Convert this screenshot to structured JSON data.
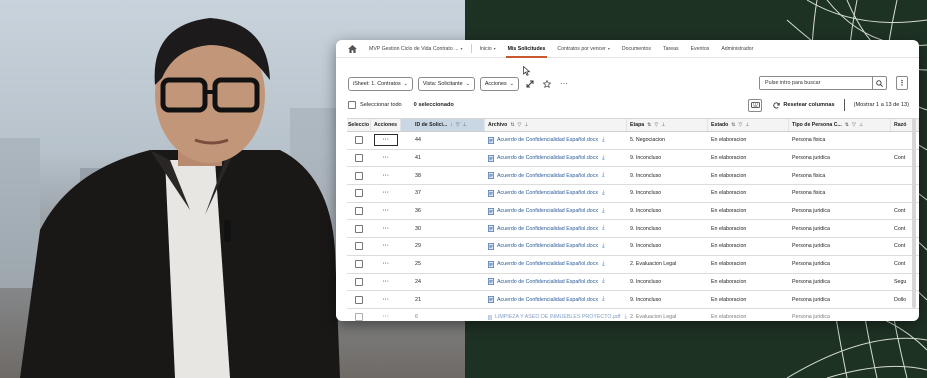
{
  "nav": {
    "items": [
      {
        "label": "MVP Gestion Ciclo de Vida Contrato ...",
        "chevron": true
      },
      {
        "label": "Inicio",
        "chevron": true
      },
      {
        "label": "Mis Solicitudes",
        "chevron": false,
        "active": true
      },
      {
        "label": "Contratos por vencer",
        "chevron": true
      },
      {
        "label": "Documentos",
        "chevron": false
      },
      {
        "label": "Tareas",
        "chevron": false
      },
      {
        "label": "Eventos",
        "chevron": false
      },
      {
        "label": "Administrador",
        "chevron": false
      }
    ]
  },
  "toolbar": {
    "sheet_label": "iSheet: 1. Contratos",
    "view_label": "Vista: Solicitante",
    "actions_label": "Acciones",
    "more_label": "···",
    "search_placeholder": "Pulse intro para buscar",
    "kebab_label": "⋮"
  },
  "selection": {
    "select_all_label": "Seleccionar todo",
    "selected_count": "0 seleccionado",
    "reset_label": "Resetear columnas",
    "range_label": "(Mostrar 1 a 13 de 13)"
  },
  "table": {
    "columns": {
      "select": "Seleccio",
      "actions": "Acciones",
      "id": "ID de Solici...",
      "file": "Archivo",
      "stage": "Etapa",
      "status": "Estado",
      "person_type": "Tipo de Persona C...",
      "reason": "Razó"
    },
    "rows": [
      {
        "actions": "···",
        "id": "44",
        "file": "Acuerdo de Confidencialidad Español.docx",
        "stage": "5. Negociacion",
        "status": "En elaboracion",
        "person_type": "Persona fisica",
        "reason": ""
      },
      {
        "actions": "···",
        "id": "41",
        "file": "Acuerdo de Confidencialidad Español.docx",
        "stage": "9. Inconcluso",
        "status": "En elaboracion",
        "person_type": "Persona juridica",
        "reason": "Cont"
      },
      {
        "actions": "···",
        "id": "38",
        "file": "Acuerdo de Confidencialidad Español.docx",
        "stage": "9. Inconcluso",
        "status": "En elaboracion",
        "person_type": "Persona fisica",
        "reason": ""
      },
      {
        "actions": "···",
        "id": "37",
        "file": "Acuerdo de Confidencialidad Español.docx",
        "stage": "9. Inconcluso",
        "status": "En elaboracion",
        "person_type": "Persona fisica",
        "reason": ""
      },
      {
        "actions": "···",
        "id": "36",
        "file": "Acuerdo de Confidencialidad Español.docx",
        "stage": "9. Inconcluso",
        "status": "En elaboracion",
        "person_type": "Persona juridica",
        "reason": "Cont"
      },
      {
        "actions": "···",
        "id": "30",
        "file": "Acuerdo de Confidencialidad Español.docx",
        "stage": "9. Inconcluso",
        "status": "En elaboracion",
        "person_type": "Persona juridica",
        "reason": "Cont"
      },
      {
        "actions": "···",
        "id": "29",
        "file": "Acuerdo de Confidencialidad Español.docx",
        "stage": "9. Inconcluso",
        "status": "En elaboracion",
        "person_type": "Persona juridica",
        "reason": "Cont"
      },
      {
        "actions": "···",
        "id": "25",
        "file": "Acuerdo de Confidencialidad Español.docx",
        "stage": "2. Evaluacion Legal",
        "status": "En elaboracion",
        "person_type": "Persona juridica",
        "reason": "Cont"
      },
      {
        "actions": "···",
        "id": "24",
        "file": "Acuerdo de Confidencialidad Español.docx",
        "stage": "9. Inconcluso",
        "status": "En elaboracion",
        "person_type": "Persona juridica",
        "reason": "Segu"
      },
      {
        "actions": "···",
        "id": "21",
        "file": "Acuerdo de Confidencialidad Español.docx",
        "stage": "9. Inconcluso",
        "status": "En elaboracion",
        "person_type": "Persona juridica",
        "reason": "Dollo"
      },
      {
        "actions": "···",
        "id": "6",
        "file": "LIMPIEZA Y ASEO DE INMUEBLES PROYECTO.pdf",
        "stage": "2. Evaluacion Legal",
        "status": "En elaboracion",
        "person_type": "Persona juridica",
        "reason": ""
      }
    ]
  },
  "colors": {
    "accent": "#c65a2e",
    "link": "#2a5b9a",
    "sorted_header": "#c9d6e3",
    "background_right": "#1e3224"
  }
}
